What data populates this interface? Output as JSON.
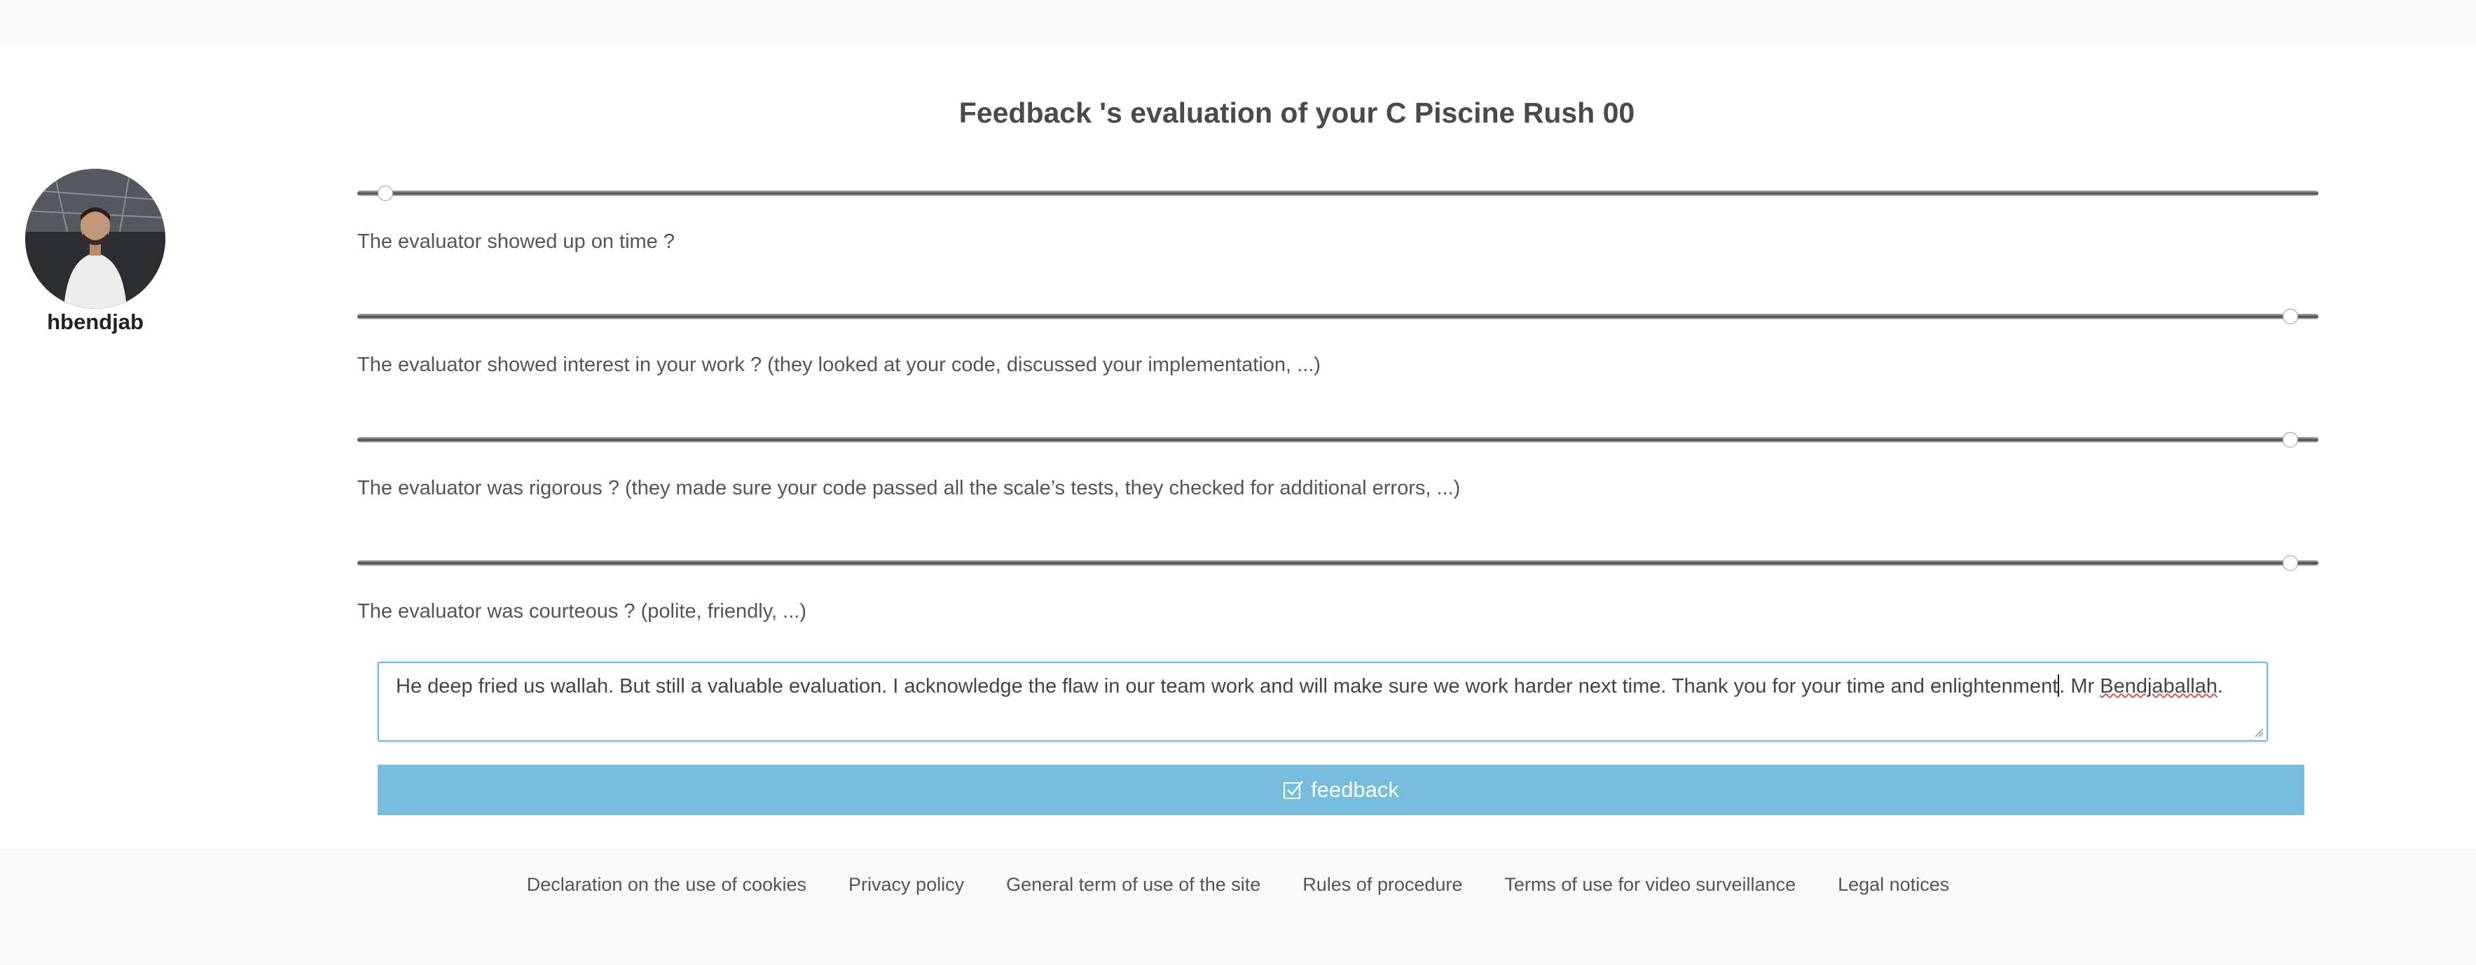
{
  "user": {
    "login": "hbendjab"
  },
  "evaluation": {
    "title": "Feedback 's evaluation of your C Piscine Rush 00",
    "questions": [
      {
        "label": "The evaluator showed up on time ?",
        "value_fraction": 0.0
      },
      {
        "label": "The evaluator showed interest in your work ? (they looked at your code, discussed your implementation, ...)",
        "value_fraction": 1.0
      },
      {
        "label": "The evaluator was rigorous ? (they made sure your code passed all the scale’s tests, they checked for additional errors, ...)",
        "value_fraction": 1.0
      },
      {
        "label": "The evaluator was courteous ? (polite, friendly, ...)",
        "value_fraction": 1.0
      }
    ],
    "comment": {
      "before_caret": "He deep fried us wallah. But still a valuable evaluation. I acknowledge the flaw in our team work and will make sure we work harder next time. Thank you for your time and enlightenment",
      "after_caret": ". Mr ",
      "misspelled": "Bendjaballah",
      "tail": "."
    },
    "submit_label": "feedback",
    "submit_icon": "checkbox-check-icon"
  },
  "footer": {
    "links": [
      "Declaration on the use of cookies",
      "Privacy policy",
      "General term of use of the site",
      "Rules of procedure",
      "Terms of use for video surveillance",
      "Legal notices"
    ]
  },
  "colors": {
    "button": "#76bcdc",
    "focus_border": "#7cb7de",
    "background": "#f8f8f8"
  }
}
